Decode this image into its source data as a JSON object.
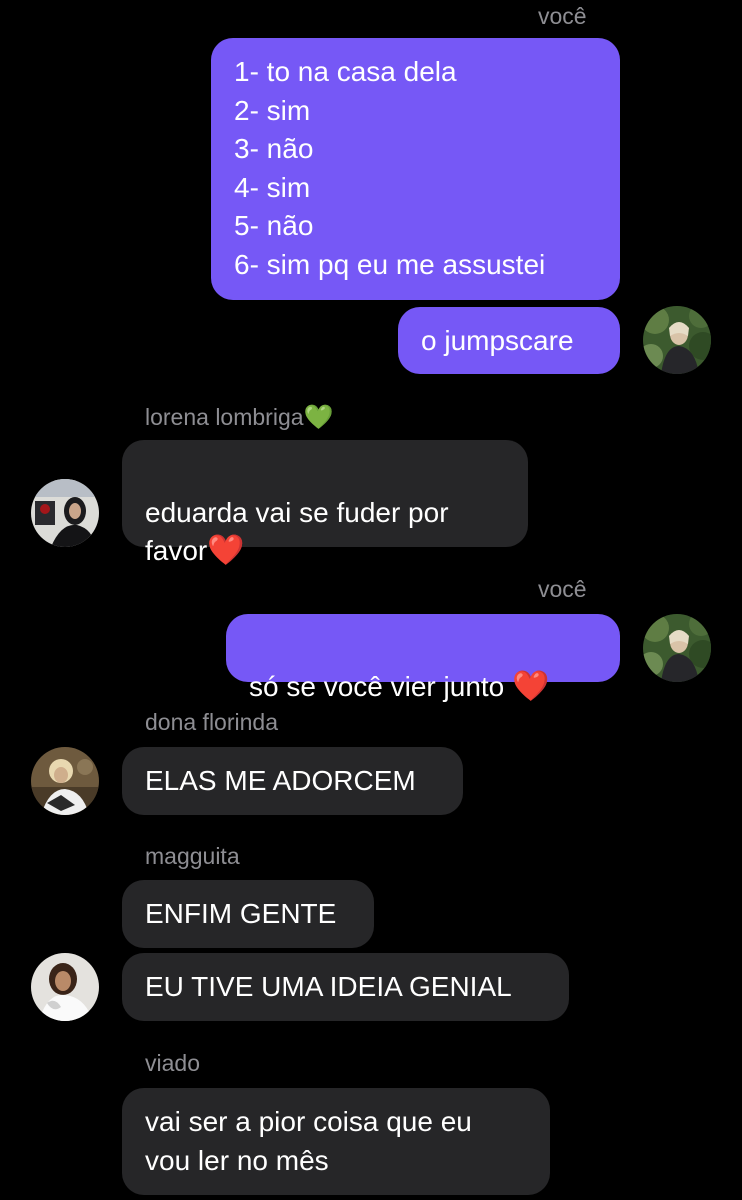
{
  "messages": {
    "m1": {
      "sender": "você",
      "text": "1- to na casa dela\n2- sim\n3- não\n4- sim\n5- não\n6- sim pq eu me assustei"
    },
    "m2": {
      "text": "o jumpscare"
    },
    "m3": {
      "sender": "lorena lombriga",
      "sender_emoji": "💚",
      "text": "eduarda vai se fuder por\nfavor",
      "emoji": "❤️"
    },
    "m4": {
      "sender": "você",
      "text": "só se você vier junto",
      "emoji": "❤️"
    },
    "m5": {
      "sender": "dona florinda",
      "text": "ELAS ME ADORCEM"
    },
    "m6": {
      "sender": "magguita",
      "text": "ENFIM GENTE"
    },
    "m7": {
      "text": "EU TIVE UMA IDEIA GENIAL"
    },
    "m8": {
      "sender": "viado",
      "text": "vai ser a pior coisa que eu\nvou ler no mês"
    }
  },
  "colors": {
    "background": "#000000",
    "outgoing_bubble": "#7658f6",
    "incoming_bubble": "#262628",
    "sender_label": "#8e8e93"
  }
}
